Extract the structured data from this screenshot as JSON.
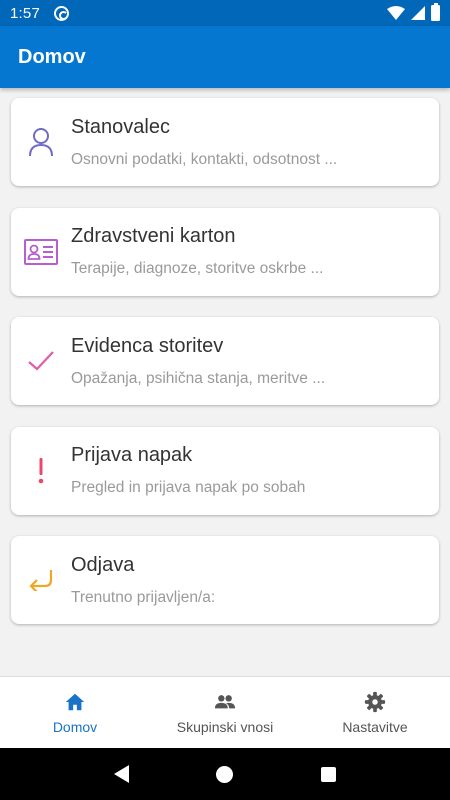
{
  "status_bar": {
    "time": "1:57"
  },
  "app_bar": {
    "title": "Domov"
  },
  "cards": [
    {
      "title": "Stanovalec",
      "subtitle": "Osnovni podatki, kontakti, odsotnost ...",
      "icon": "person-icon",
      "color": "#6f6cc4"
    },
    {
      "title": "Zdravstveni karton",
      "subtitle": "Terapije, diagnoze, storitve oskrbe ...",
      "icon": "id-card-icon",
      "color": "#b85fcf"
    },
    {
      "title": "Evidenca storitev",
      "subtitle": "Opažanja, psihična stanja, meritve ...",
      "icon": "checkmark-icon",
      "color": "#e25aa8"
    },
    {
      "title": "Prijava napak",
      "subtitle": "Pregled in prijava napak po sobah",
      "icon": "exclamation-icon",
      "color": "#e8486a"
    },
    {
      "title": "Odjava",
      "subtitle": "Trenutno prijavljen/a:",
      "icon": "return-arrow-icon",
      "color": "#eda824"
    }
  ],
  "bottom_nav": {
    "items": [
      {
        "label": "Domov",
        "icon": "home-icon",
        "active": true
      },
      {
        "label": "Skupinski vnosi",
        "icon": "group-icon",
        "active": false
      },
      {
        "label": "Nastavitve",
        "icon": "settings-icon",
        "active": false
      }
    ],
    "active_color": "#1a73c8",
    "inactive_color": "#555555"
  },
  "theme": {
    "status_bar": "#0167b8",
    "app_bar": "#0677d1",
    "background": "#f2f2f2"
  }
}
